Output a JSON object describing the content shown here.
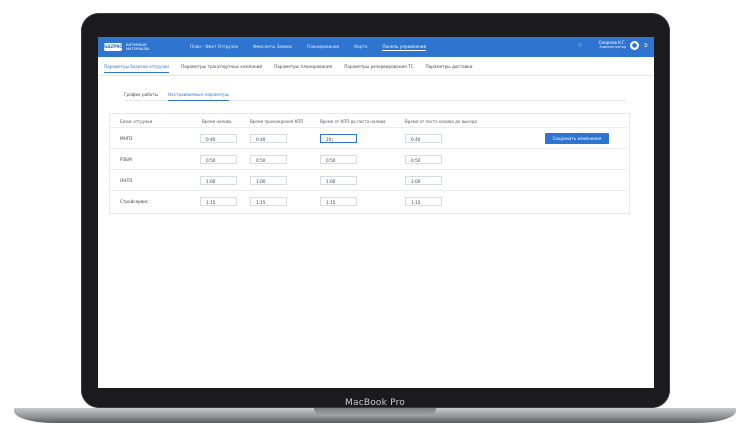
{
  "app": {
    "logo_mark": "GAZPROM",
    "logo_text": "БИТУМНЫЕ МАТЕРИАЛЫ",
    "nav": [
      "План - Факт Отгрузок",
      "Фиксанты Заявок",
      "Планирование",
      "Карта",
      "Панель управления"
    ],
    "active_nav_index": 4,
    "user_name": "Смирнов К.Г.",
    "user_role": "Администратор"
  },
  "subnav": {
    "tabs": [
      "Параметры базисов отгрузки",
      "Параметры транспортных компаний",
      "Параметры планирования",
      "Параметры резервирования ТС",
      "Параметры доставки"
    ]
  },
  "inner_tabs": [
    "График работы",
    "Настраиваемые параметры"
  ],
  "table": {
    "headers": [
      "Базис отгрузки",
      "Время налива",
      "Время прохождения КПП",
      "Время от КПП до поста налива",
      "Время от поста налива до выезда"
    ],
    "rows": [
      {
        "basis": "МНПЗ",
        "values": [
          "0:40",
          "0:40",
          "20|",
          "0:40"
        ]
      },
      {
        "basis": "РЗБМ",
        "values": [
          "0:50",
          "0:50",
          "0:50",
          "0:50"
        ]
      },
      {
        "basis": "ОНПЗ",
        "values": [
          "1:00",
          "1:00",
          "1:00",
          "1:00"
        ]
      },
      {
        "basis": "Стройсервис",
        "values": [
          "1:15",
          "1:15",
          "1:15",
          "1:15"
        ]
      }
    ]
  },
  "buttons": {
    "save": "Сохранить изменения"
  },
  "device": {
    "brand": "MacBook Pro"
  },
  "colors": {
    "accent": "#2f74cf",
    "text": "#3b4150",
    "border": "#d7dbe2"
  }
}
